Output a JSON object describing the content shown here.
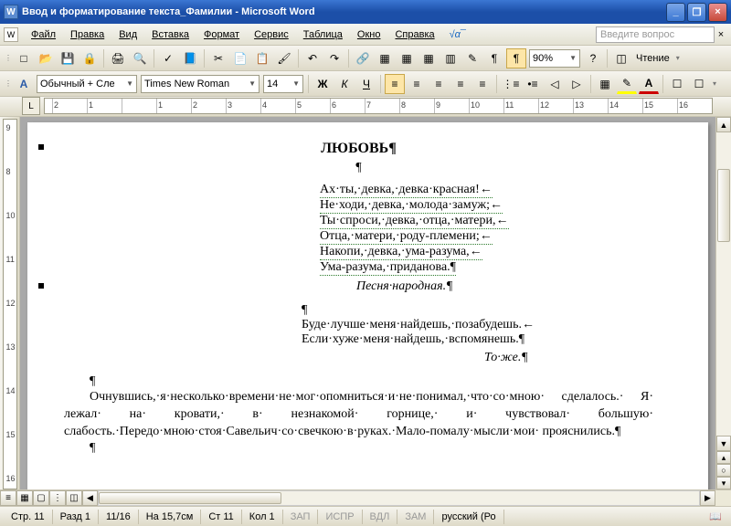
{
  "title": "Ввод и форматирование текста_Фамилии - Microsoft Word",
  "menu": [
    "Файл",
    "Правка",
    "Вид",
    "Вставка",
    "Формат",
    "Сервис",
    "Таблица",
    "Окно",
    "Справка"
  ],
  "math_label": "√α¯",
  "ask": "Введите вопрос",
  "zoom": "90%",
  "reading": "Чтение",
  "format": {
    "style": "Обычный + Сле",
    "font": "Times New Roman",
    "size": "14",
    "bold": "Ж",
    "italic": "К",
    "underline": "Ч"
  },
  "ruler_h": [
    "2",
    "1",
    "",
    "1",
    "2",
    "3",
    "4",
    "5",
    "6",
    "7",
    "8",
    "9",
    "10",
    "11",
    "12",
    "13",
    "14",
    "15",
    "16"
  ],
  "ruler_v": [
    "9",
    "8",
    "10",
    "11",
    "12",
    "13",
    "14",
    "15",
    "16"
  ],
  "icons": {
    "new": "□",
    "open": "📂",
    "save": "💾",
    "perm": "🔒",
    "print": "🖨",
    "preview": "🔍",
    "spell": "✓",
    "research": "📘",
    "cut": "✂",
    "copy": "📄",
    "paste": "📋",
    "fmtpaint": "🖌",
    "undo": "↶",
    "redo": "↷",
    "link": "🔗",
    "tables": "▦",
    "table": "▦",
    "excel": "▦",
    "cols": "▥",
    "draw": "✎",
    "docmap": "¶",
    "show": "¶",
    "help": "?",
    "al": "≡",
    "ac": "≡",
    "ar": "≡",
    "aj": "≡",
    "linesp": "≡",
    "numlist": "⋮≡",
    "bullist": "•≡",
    "outdent": "◁",
    "indent": "▷",
    "borders": "▦",
    "hilit": "✎",
    "fontcol": "A"
  },
  "doc": {
    "title": "ЛЮБОВЬ¶",
    "empty_p": "¶",
    "poem": [
      "Ах·ты,·девка,·девка·красная!←",
      "Не·ходи,·девка,·молода·замуж;←",
      "Ты·спроси,·девка,·отца,·матери,←",
      "Отца,·матери,·роду-племени;←",
      "Накопи,·девка,·ума-разума,←",
      "Ума-разума,·приданова.¶"
    ],
    "attrib1": "Песня·народная.¶",
    "block2l1": "Буде·лучше·меня·найдешь,·позабудешь.←",
    "block2l2": "Если·хуже·меня·найдешь,·вспомянешь.¶",
    "attrib2": "То·же.¶",
    "body": "Очнувшись,·я·несколько·времени·не·мог·опомниться·и·не·понимал,·что·со·мною· сделалось.· Я· лежал· на· кровати,· в· незнакомой· горнице,· и· чувствовал· большую· слабость.·Передо·мною·стоя·Савельич·со·свечкою·в·руках.·Мало-помалу·мысли·мои· прояснились.¶",
    "tail": "¶"
  },
  "status": {
    "page": "Стр. 11",
    "sec": "Разд 1",
    "pages": "11/16",
    "at": "На 15,7см",
    "line": "Ст 11",
    "col": "Кол 1",
    "zap": "ЗАП",
    "ispr": "ИСПР",
    "vdl": "ВДЛ",
    "zam": "ЗАМ",
    "lang": "русский (Ро"
  }
}
